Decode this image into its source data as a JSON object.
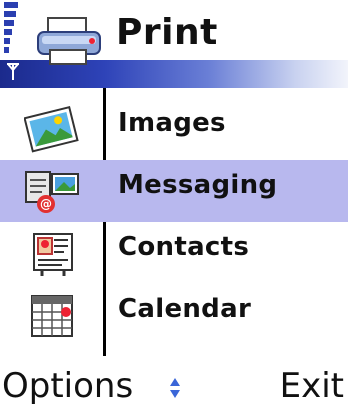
{
  "header": {
    "title": "Print"
  },
  "items": [
    {
      "label": "Images",
      "icon": "images-icon"
    },
    {
      "label": "Messaging",
      "icon": "messaging-icon",
      "selected": true
    },
    {
      "label": "Contacts",
      "icon": "contacts-icon"
    },
    {
      "label": "Calendar",
      "icon": "calendar-icon"
    }
  ],
  "softkeys": {
    "left": "Options",
    "right": "Exit"
  },
  "colors": {
    "highlight": "#b8b8ee",
    "title_gradient_start": "#1b2a8c",
    "scroll_indicator": "#3a66d8"
  }
}
